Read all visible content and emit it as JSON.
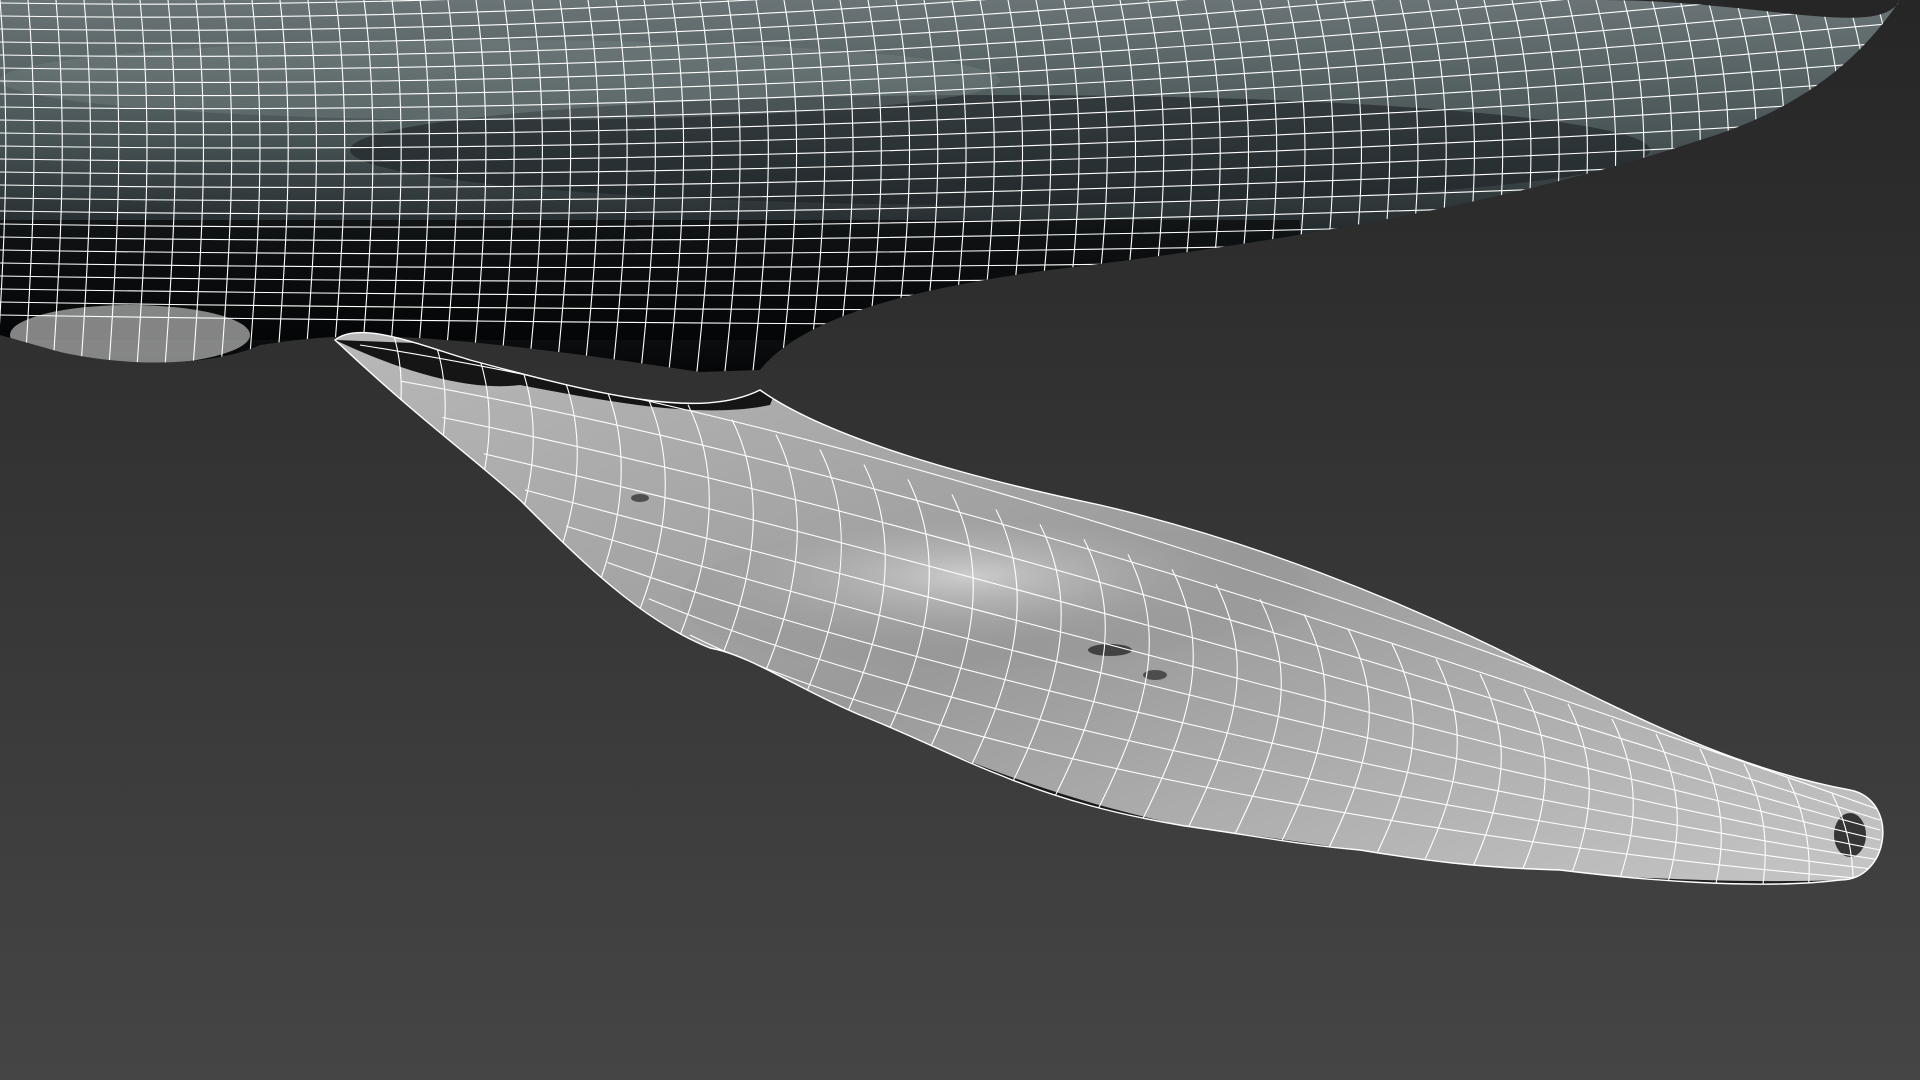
{
  "viewport": {
    "background_top": "#262626",
    "background_bottom": "#454545",
    "wire_color": "#ffffff",
    "body_shade_dark": "#0a0c0e",
    "body_shade_mid": "#4a5658",
    "fin_shade_light": "#cfcfcf",
    "fin_shade_mid": "#8c8c8c"
  },
  "model": {
    "display_mode": "wireframe-on-shaded",
    "parts": [
      "whale-body",
      "pectoral-fin"
    ]
  }
}
